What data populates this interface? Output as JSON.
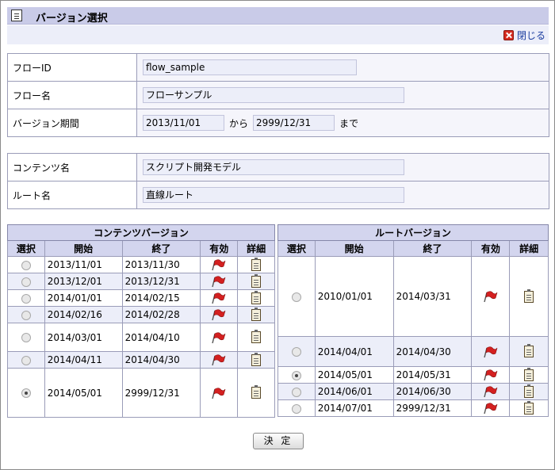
{
  "window": {
    "title": "バージョン選択",
    "close_label": "閉じる"
  },
  "flow_form": {
    "flow_id_label": "フローID",
    "flow_id_value": "flow_sample",
    "flow_name_label": "フロー名",
    "flow_name_value": "フローサンプル",
    "period_label": "バージョン期間",
    "period_start": "2013/11/01",
    "period_from": "から",
    "period_end": "2999/12/31",
    "period_to": "まで"
  },
  "content_form": {
    "content_name_label": "コンテンツ名",
    "content_name_value": "スクリプト開発モデル",
    "route_name_label": "ルート名",
    "route_name_value": "直線ルート"
  },
  "content_versions": {
    "caption": "コンテンツバージョン",
    "columns": [
      "選択",
      "開始",
      "終了",
      "有効",
      "詳細"
    ],
    "rows": [
      {
        "start": "2013/11/01",
        "end": "2013/11/30",
        "selected": false
      },
      {
        "start": "2013/12/01",
        "end": "2013/12/31",
        "selected": false
      },
      {
        "start": "2014/01/01",
        "end": "2014/02/15",
        "selected": false
      },
      {
        "start": "2014/02/16",
        "end": "2014/02/28",
        "selected": false
      },
      {
        "start": "2014/03/01",
        "end": "2014/04/10",
        "selected": false
      },
      {
        "start": "2014/04/11",
        "end": "2014/04/30",
        "selected": false
      },
      {
        "start": "2014/05/01",
        "end": "2999/12/31",
        "selected": true
      }
    ]
  },
  "route_versions": {
    "caption": "ルートバージョン",
    "columns": [
      "選択",
      "開始",
      "終了",
      "有効",
      "詳細"
    ],
    "rows": [
      {
        "start": "2010/01/01",
        "end": "2014/03/31",
        "selected": false
      },
      {
        "start": "2014/04/01",
        "end": "2014/04/30",
        "selected": false
      },
      {
        "start": "2014/05/01",
        "end": "2014/05/31",
        "selected": true
      },
      {
        "start": "2014/06/01",
        "end": "2014/06/30",
        "selected": false
      },
      {
        "start": "2014/07/01",
        "end": "2999/12/31",
        "selected": false
      }
    ]
  },
  "actions": {
    "decide_label": "決 定"
  },
  "icons": {
    "title": "clipboard-icon",
    "close": "close-x-icon",
    "valid": "red-flag-icon",
    "detail": "clipboard-icon"
  },
  "colors": {
    "header_bg": "#c9cbe8",
    "row_alt": "#eceef9",
    "close_icon": "#d42b1f",
    "flag": "#d42020"
  }
}
